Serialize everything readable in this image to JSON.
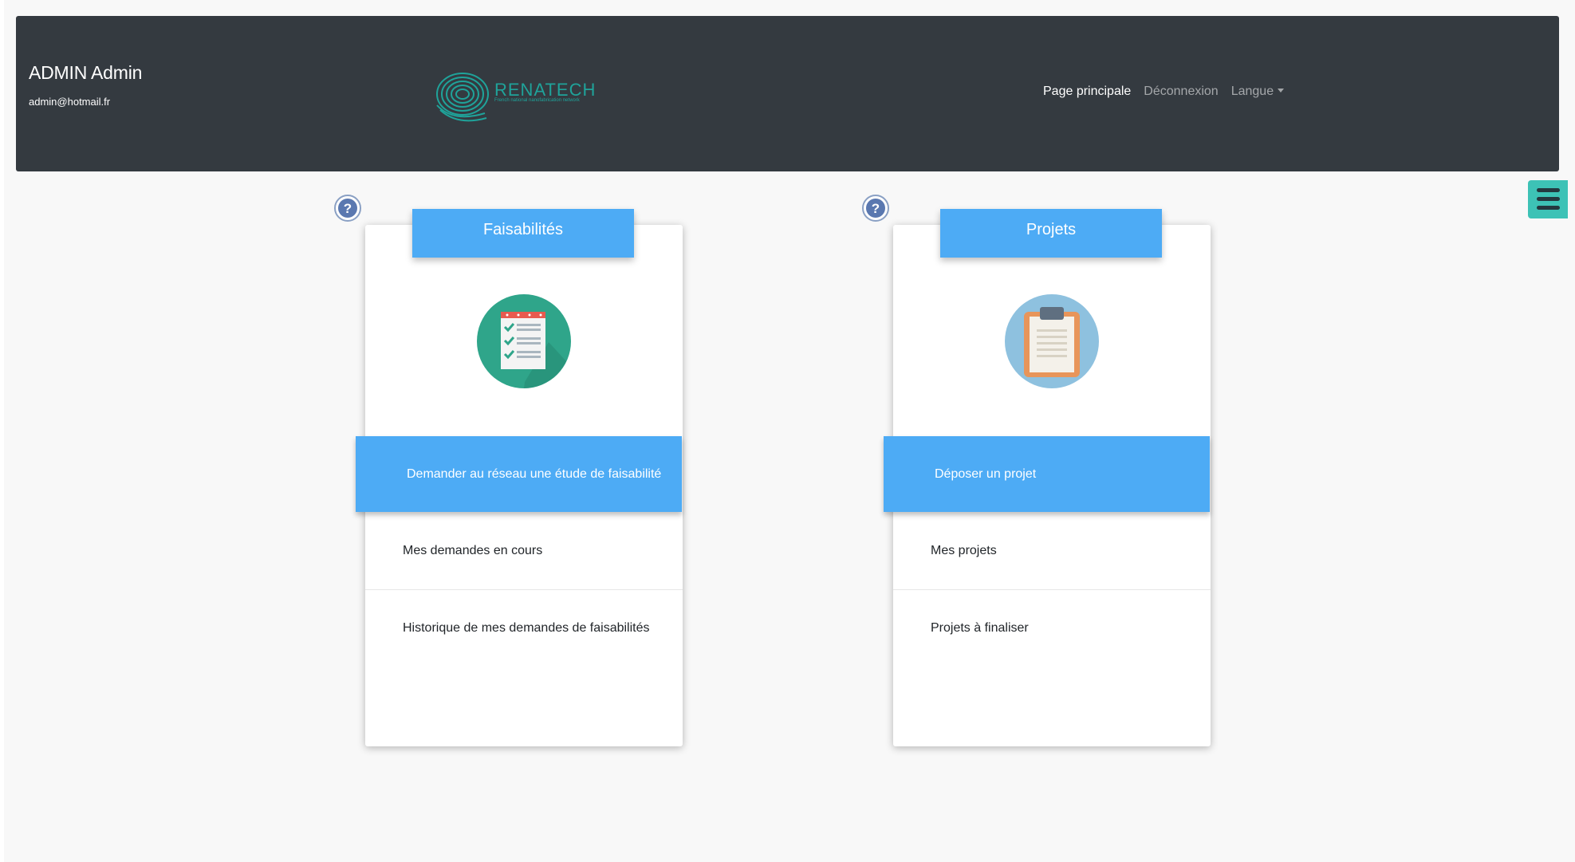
{
  "user": {
    "name": "ADMIN Admin",
    "email": "admin@hotmail.fr"
  },
  "logo": {
    "text": "RENATECH",
    "subtitle": "French national nanofabrication network"
  },
  "nav": {
    "home": "Page principale",
    "logout": "Déconnexion",
    "language": "Langue"
  },
  "colors": {
    "navbar": "#343a40",
    "accent": "#4dabf5",
    "menu_toggle": "#3dc2b6",
    "logo": "#1fa39a"
  },
  "cards": [
    {
      "title": "Faisabilités",
      "icon": "checklist-icon",
      "primary_action": "Demander au réseau une étude de faisabilité",
      "items": [
        "Mes demandes en cours",
        "Historique de mes demandes de faisabilités"
      ]
    },
    {
      "title": "Projets",
      "icon": "clipboard-icon",
      "primary_action": "Déposer un projet",
      "items": [
        "Mes projets",
        "Projets à finaliser"
      ]
    }
  ]
}
